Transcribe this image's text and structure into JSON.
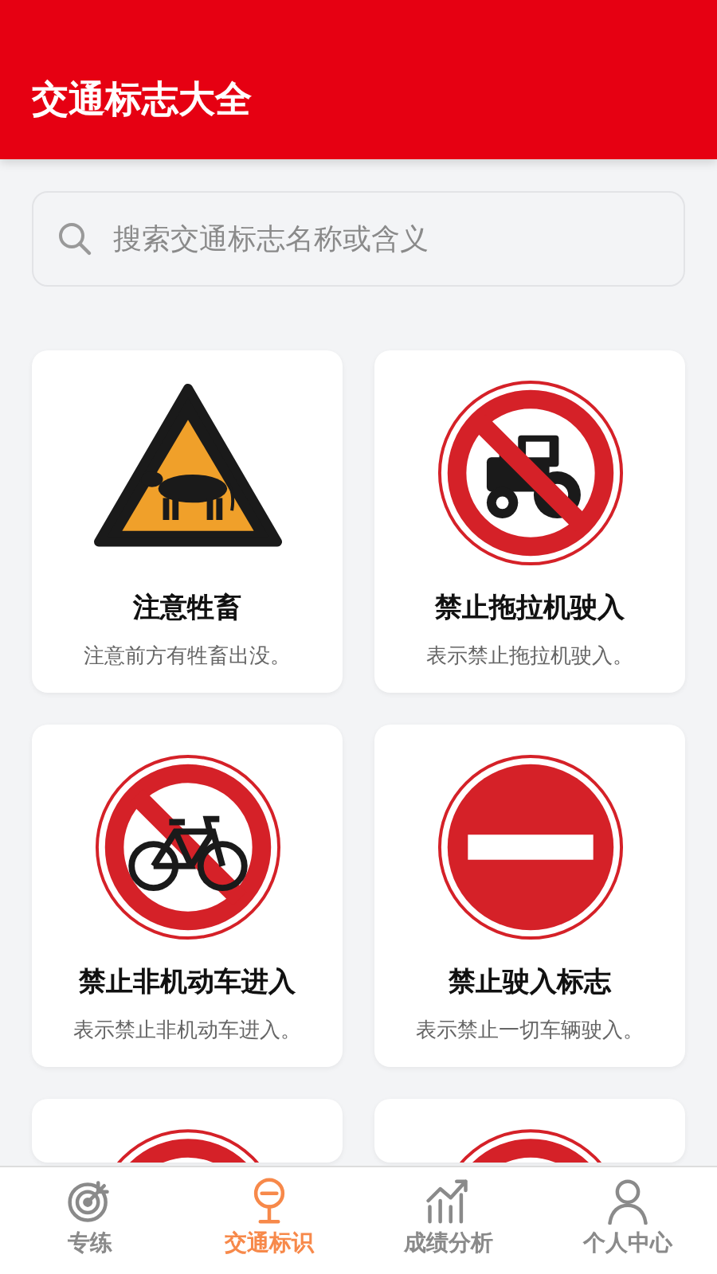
{
  "header": {
    "title": "交通标志大全"
  },
  "search": {
    "placeholder": "搜索交通标志名称或含义"
  },
  "signs": [
    {
      "kind": "warning-cattle",
      "name": "注意牲畜",
      "description": "注意前方有牲畜出没。"
    },
    {
      "kind": "no-tractor",
      "name": "禁止拖拉机驶入",
      "description": "表示禁止拖拉机驶入。"
    },
    {
      "kind": "no-bicycle",
      "name": "禁止非机动车进入",
      "description": "表示禁止非机动车进入。"
    },
    {
      "kind": "no-entry",
      "name": "禁止驶入标志",
      "description": "表示禁止一切车辆驶入。"
    },
    {
      "kind": "prohibition"
    },
    {
      "kind": "prohibition"
    }
  ],
  "tabs": [
    {
      "label": "专练",
      "selected": false
    },
    {
      "label": "交通标识",
      "selected": true
    },
    {
      "label": "成绩分析",
      "selected": false
    },
    {
      "label": "个人中心",
      "selected": false
    }
  ]
}
